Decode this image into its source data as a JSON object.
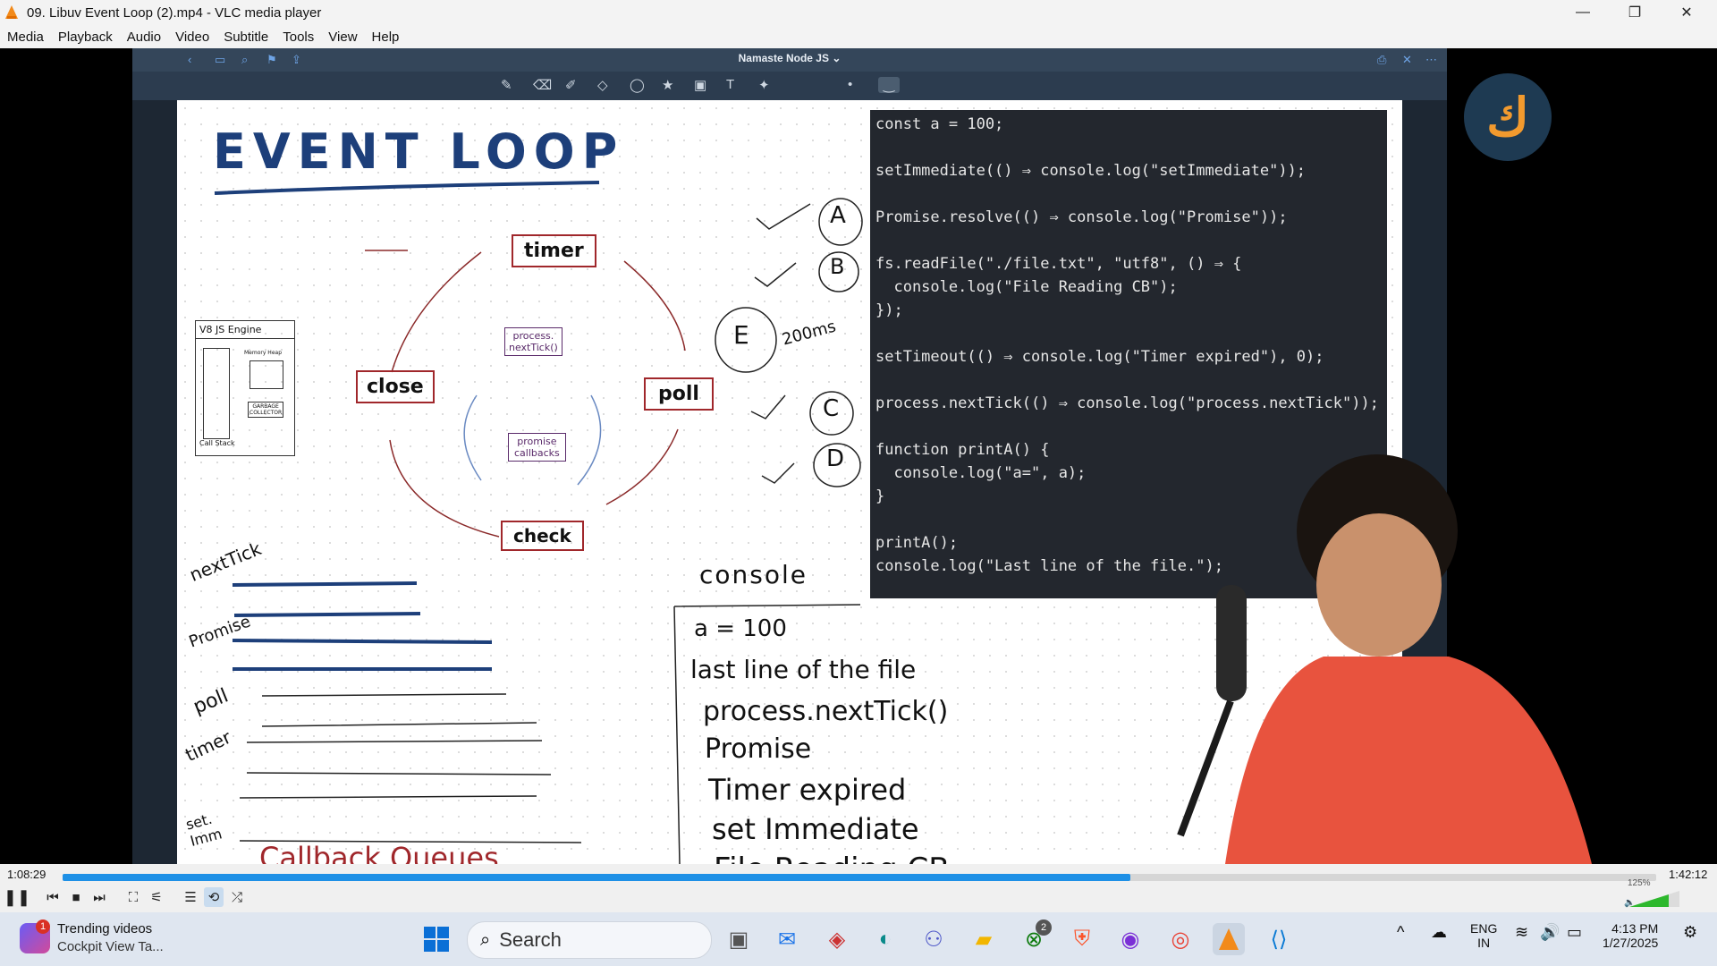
{
  "window": {
    "title": "09. Libuv  Event Loop (2).mp4 - VLC media player",
    "controls": {
      "minimize": "—",
      "maximize": "❐",
      "close": "✕"
    }
  },
  "menu": [
    "Media",
    "Playback",
    "Audio",
    "Video",
    "Subtitle",
    "Tools",
    "View",
    "Help"
  ],
  "video": {
    "notes_app_title": "Namaste Node JS ⌄",
    "heading": "EVENT LOOP",
    "diagram": {
      "timer": "timer",
      "poll": "poll",
      "check": "check",
      "close": "close",
      "inner_top": "process.\nnextTick()",
      "inner_bottom": "promise\ncallbacks"
    },
    "v8_box": {
      "title": "V8  JS Engine",
      "left_label": "Call Stack",
      "memory": "Memory Heap",
      "gc": "GARBAGE\nCOLLECTOR"
    },
    "queues": {
      "nexttick": "nextTick",
      "promise": "Promise",
      "poll": "poll",
      "timer": "timer",
      "setimmediate": "set.\nImm",
      "caption": "Callback Queues"
    },
    "marks": {
      "a": "A",
      "b": "B",
      "e": "E",
      "c": "C",
      "d": "D",
      "ms": "200ms"
    },
    "console": {
      "label": "console",
      "lines": [
        "a = 100",
        "last line of the file",
        "process.nextTick()",
        "Promise",
        "Timer expired",
        "set Immediate",
        "File Reading CB"
      ]
    },
    "code": [
      "const a = 100;",
      "setImmediate(() ⇒ console.log(\"setImmediate\"));",
      "Promise.resolve(() ⇒ console.log(\"Promise\"));",
      "fs.readFile(\"./file.txt\", \"utf8\", () ⇒ {",
      "  console.log(\"File Reading CB\");",
      "});",
      "setTimeout(() ⇒ console.log(\"Timer expired\"), 0);",
      "process.nextTick(() ⇒ console.log(\"process.nextTick\"));",
      "function printA() {",
      "  console.log(\"a=\", a);",
      "}",
      "printA();",
      "console.log(\"Last line of the file.\");"
    ]
  },
  "player": {
    "elapsed": "1:08:29",
    "total": "1:42:12",
    "progress": 0.67,
    "volume": "125%"
  },
  "taskbar": {
    "widget_title": "Trending videos",
    "widget_sub": "Cockpit View Ta...",
    "widget_badge": "1",
    "search_label": "Search",
    "xbox_badge": "2",
    "lang1": "ENG",
    "lang2": "IN",
    "time": "4:13 PM",
    "date": "1/27/2025"
  }
}
